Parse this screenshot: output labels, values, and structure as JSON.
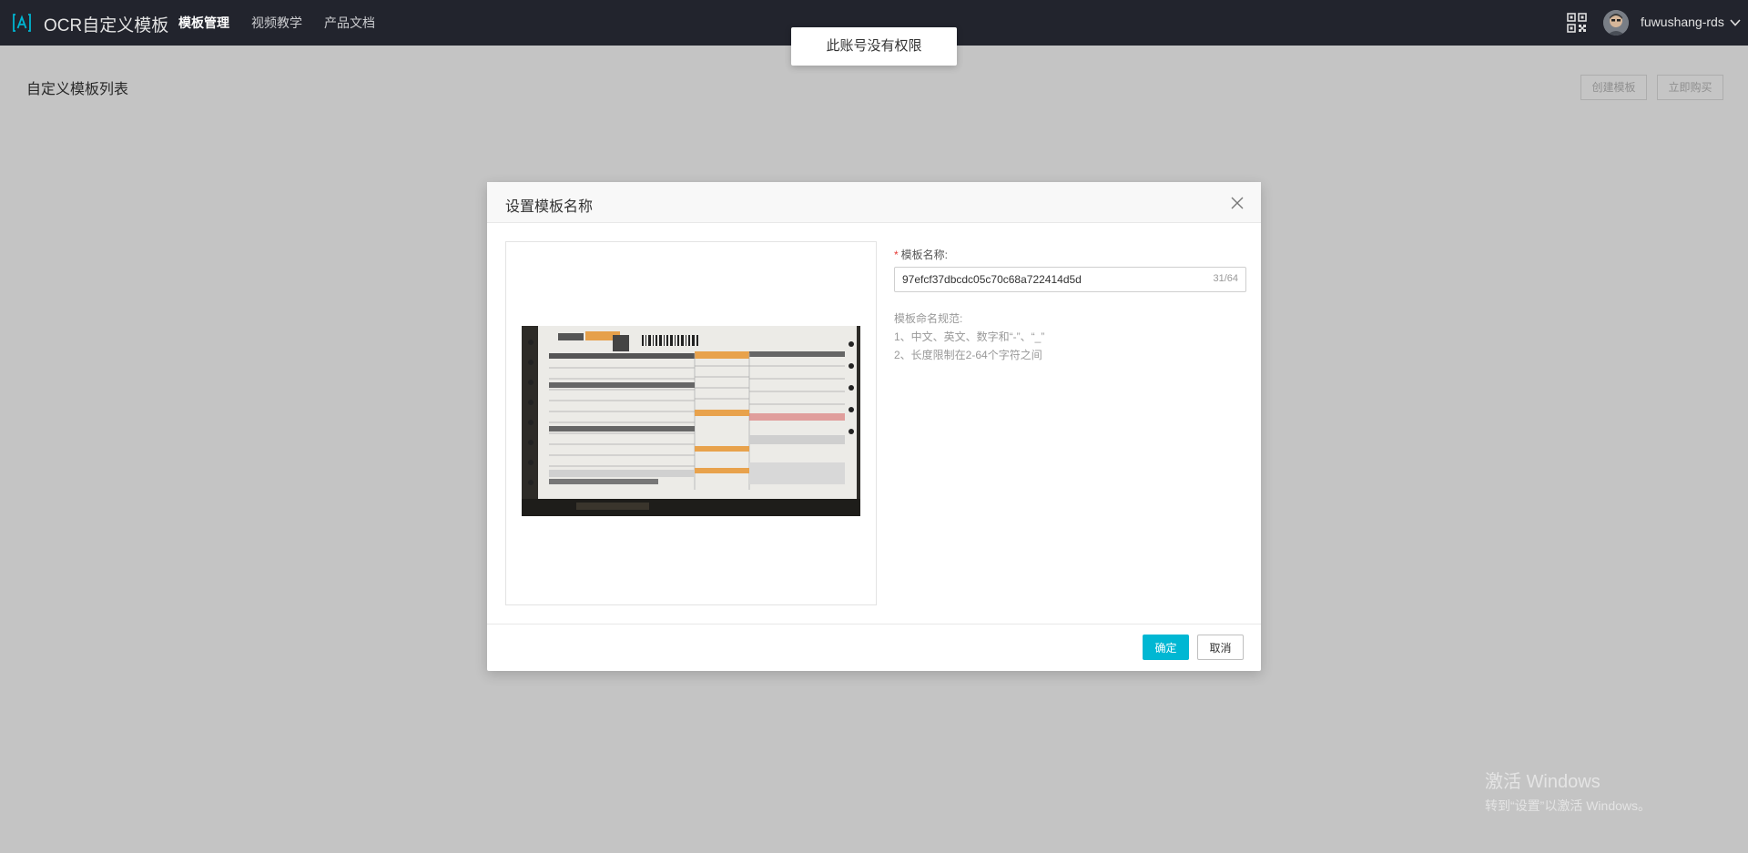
{
  "header": {
    "brand": "OCR自定义模板",
    "nav": [
      {
        "label": "模板管理"
      },
      {
        "label": "视频教学"
      },
      {
        "label": "产品文档"
      }
    ],
    "username": "fuwushang-rds",
    "icons": {
      "logo": "ocr-logo-icon",
      "qr": "qr-code-icon",
      "chevron": "chevron-down-icon"
    },
    "accent": "#00b7d3"
  },
  "page": {
    "title": "自定义模板列表",
    "create_label": "创建模板",
    "buy_label": "立即购买"
  },
  "toast": {
    "message": "此账号没有权限"
  },
  "dialog": {
    "title": "设置模板名称",
    "field_label": "模板名称:",
    "required_mark": "*",
    "name_value": "97efcf37dbcdc05c70c68a722414d5d",
    "counter": "31/64",
    "rules": [
      "模板命名规范:",
      "1、中文、英文、数字和“-”、“_”",
      "2、长度限制在2-64个字符之间"
    ],
    "ok_label": "确定",
    "cancel_label": "取消"
  },
  "watermark": {
    "line1": "激活 Windows",
    "line2": "转到“设置”以激活 Windows。"
  }
}
